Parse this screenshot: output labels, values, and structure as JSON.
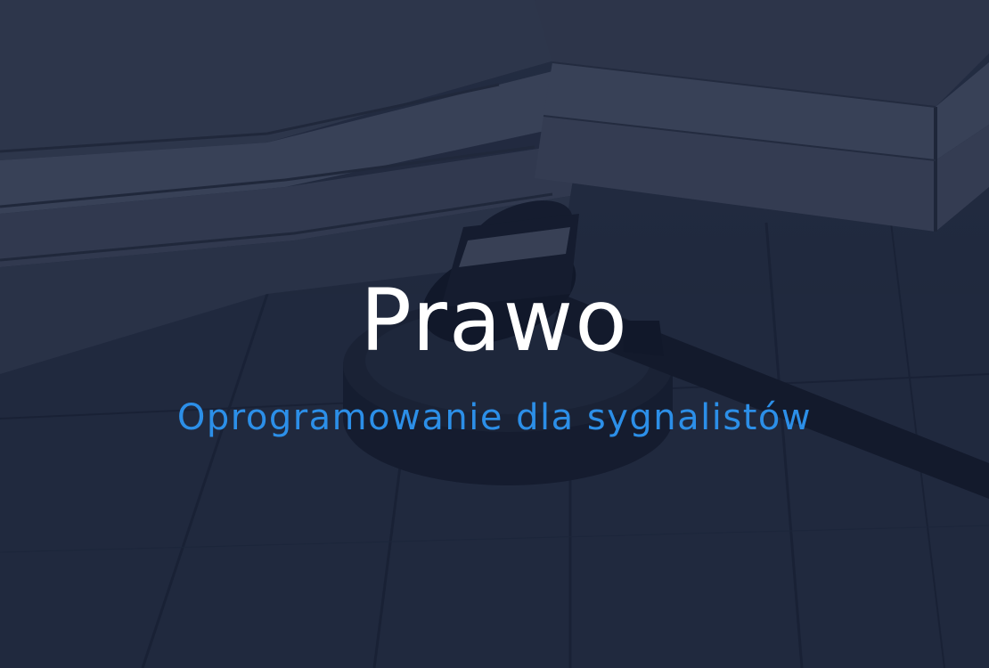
{
  "hero": {
    "title": "Prawo",
    "subtitle": "Oprogramowanie dla sygnalistów"
  },
  "colors": {
    "title": "#ffffff",
    "subtitle": "#2c8fe8",
    "overlay": "#1f2a3d"
  },
  "background_image": {
    "icon": "gavel-and-law-books-photo"
  }
}
